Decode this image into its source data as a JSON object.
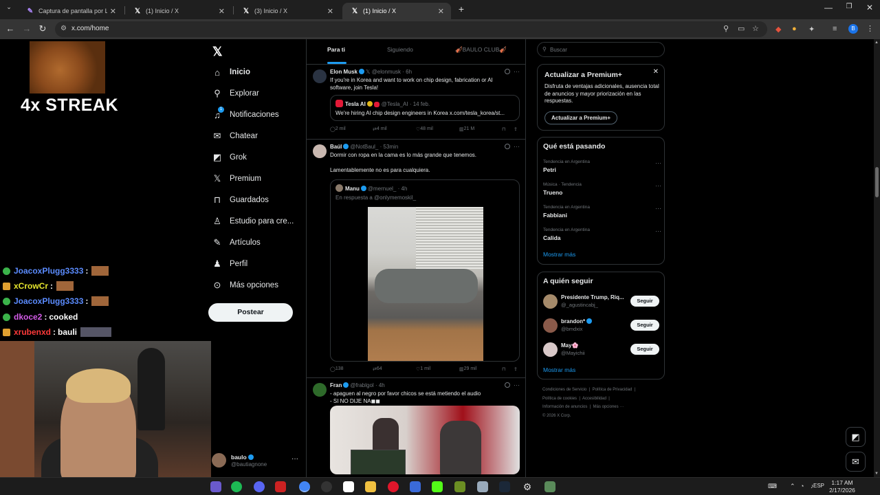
{
  "browser": {
    "tabs": [
      {
        "title": "Captura de pantalla por Lightsh",
        "icon": "feather-icon"
      },
      {
        "title": "(1) Inicio / X",
        "icon": "x-logo-icon"
      },
      {
        "title": "(3) Inicio / X",
        "icon": "x-logo-icon"
      },
      {
        "title": "(1) Inicio / X",
        "icon": "x-logo-icon",
        "active": true
      }
    ],
    "url": "x.com/home"
  },
  "overlay": {
    "streak": "4x STREAK",
    "chat": [
      {
        "user": "JoacoxPlugg3333",
        "sep": ":",
        "msg": "",
        "color": "#5b8cff"
      },
      {
        "user": "xCrowCr",
        "sep": ":",
        "msg": "",
        "color": "#e6e62e"
      },
      {
        "user": "JoacoxPlugg3333",
        "sep": ":",
        "msg": "",
        "color": "#5b8cff"
      },
      {
        "user": "dkoce2",
        "sep": ":",
        "msg": "cooked",
        "color": "#d45ce8"
      },
      {
        "user": "xrubenxd",
        "sep": ":",
        "msg": "bauli",
        "color": "#ff3a3a"
      }
    ]
  },
  "nav": {
    "items": [
      {
        "label": "Inicio",
        "icon": "home-icon",
        "glyph": "⌂"
      },
      {
        "label": "Explorar",
        "icon": "search-icon",
        "glyph": "⚲"
      },
      {
        "label": "Notificaciones",
        "icon": "bell-icon",
        "glyph": "🔔"
      },
      {
        "label": "Chatear",
        "icon": "mail-icon",
        "glyph": "✉"
      },
      {
        "label": "Grok",
        "icon": "grok-icon",
        "glyph": "◩"
      },
      {
        "label": "Premium",
        "icon": "x-logo-icon",
        "glyph": "𝕏"
      },
      {
        "label": "Guardados",
        "icon": "bookmark-icon",
        "glyph": "⊓"
      },
      {
        "label": "Estudio para cre...",
        "icon": "studio-icon",
        "glyph": "♙"
      },
      {
        "label": "Artículos",
        "icon": "article-icon",
        "glyph": "✎"
      },
      {
        "label": "Perfil",
        "icon": "person-icon",
        "glyph": "♟"
      },
      {
        "label": "Más opciones",
        "icon": "more-circle-icon",
        "glyph": "⊙"
      }
    ],
    "notif_badge": "1",
    "post_label": "Postear",
    "profile": {
      "name": "baulo",
      "handle": "@bautiagnone"
    }
  },
  "feed": {
    "tabs": [
      "Para ti",
      "Siguiendo",
      "🎻BAULO CLUB🎻"
    ],
    "tweets": [
      {
        "name": "Elon Musk",
        "handle": "@elonmusk",
        "time": "· 6h",
        "text": [
          "If you're in Korea and want to work on chip design, fabrication or AI",
          "software, join Tesla!"
        ],
        "quote": {
          "name": "Tesla AI",
          "handle": "@Tesla_AI",
          "time": "· 14 feb.",
          "text": "We're hiring AI chip design engineers in Korea x.com/tesla_korea/st..."
        },
        "stats": {
          "replies": "2 mil",
          "reposts": "4 mil",
          "likes": "48 mil",
          "views": "21 M"
        }
      },
      {
        "name": "Baúl",
        "handle": "@NotBaul_",
        "time": "· 53min",
        "text": [
          "Dormir con ropa en la cama es lo más grande que tenemos.",
          "",
          "Lamentablemente no es para cualquiera."
        ],
        "quote": {
          "name": "Manu",
          "handle": "@mernuel_",
          "time": "· 4h",
          "reply_to": "En respuesta a @onlymemoskil_"
        },
        "stats": {
          "replies": "138",
          "reposts": "64",
          "likes": "1 mil",
          "views": "29 mil"
        }
      },
      {
        "name": "Fran",
        "handle": "@frablgol",
        "time": "· 4h",
        "text": [
          "- apaguen al negro por favor chicos se está metiendo el audio",
          "- SI NO DIJE NA◼◼"
        ]
      }
    ]
  },
  "sidebar": {
    "search_placeholder": "Buscar",
    "premium": {
      "title": "Actualizar a Premium+",
      "desc": "Disfruta de ventajas adicionales, ausencia total de anuncios y mayor priorización en las respuestas.",
      "button": "Actualizar a Premium+"
    },
    "trends_title": "Qué está pasando",
    "trends": [
      {
        "context": "Tendencia en Argentina",
        "topic": "Petri"
      },
      {
        "context": "Música · Tendencia",
        "topic": "Trueno"
      },
      {
        "context": "Tendencia en Argentina",
        "topic": "Fabbiani"
      },
      {
        "context": "Tendencia en Argentina",
        "topic": "Calida"
      }
    ],
    "show_more": "Mostrar más",
    "follow_title": "A quién seguir",
    "follow": [
      {
        "name": "Presidente Trump, Riq...",
        "handle": "@_agustincabj_"
      },
      {
        "name": "brandon*",
        "handle": "@bmdxix"
      },
      {
        "name": "May🌸",
        "handle": "@Mayichii"
      }
    ],
    "follow_label": "Seguir",
    "footer": [
      "Condiciones de Servicio",
      "Política de Privacidad",
      "Política de cookies",
      "Accesibilidad",
      "Información de anuncios",
      "Más opciones ···",
      "© 2026 X Corp."
    ]
  },
  "taskbar": {
    "lang": "ESP",
    "time": "1:17 AM",
    "date": "2/17/2026"
  }
}
